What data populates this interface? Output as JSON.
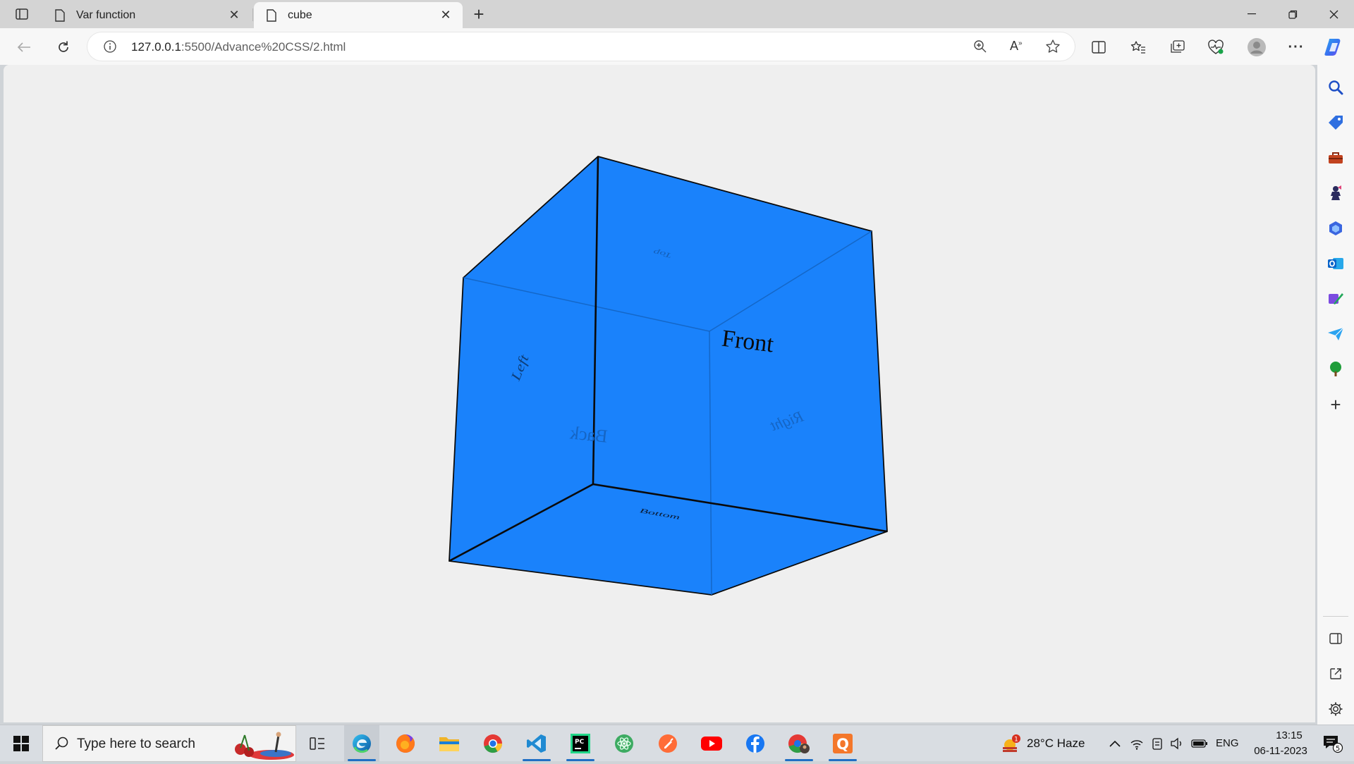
{
  "tabs": [
    {
      "title": "Var function",
      "active": false
    },
    {
      "title": "cube",
      "active": true
    }
  ],
  "address": {
    "host": "127.0.0.1",
    "path": ":5500/Advance%20CSS/2.html"
  },
  "cube": {
    "color": "#1a82fb",
    "faces": {
      "front": "Front",
      "back": "Back",
      "left": "Left",
      "right": "Right",
      "top": "Top",
      "bottom": "Bottom"
    }
  },
  "sidebar_icons": [
    "search-icon",
    "shopping-tag-icon",
    "tools-icon",
    "games-icon",
    "microsoft-365-icon",
    "outlook-icon",
    "designer-icon",
    "send-icon",
    "tree-icon",
    "add-icon",
    "split-screen-icon",
    "open-external-icon",
    "settings-icon"
  ],
  "taskbar": {
    "search_placeholder": "Type here to search",
    "weather": "28°C  Haze",
    "weather_badge": "1",
    "lang": "ENG",
    "time": "13:15",
    "date": "06-11-2023",
    "notification_count": "5",
    "apps": [
      "task-view-icon",
      "edge-icon",
      "firefox-icon",
      "file-explorer-icon",
      "chrome-icon",
      "vscode-icon",
      "pycharm-icon",
      "atom-icon",
      "postman-icon",
      "youtube-icon",
      "facebook-icon",
      "chrome-profile-icon",
      "q-app-icon"
    ]
  },
  "colors": {
    "accent": "#1f6fc4",
    "page_bg": "#efefef",
    "cube_blue": "#1a82fb"
  }
}
